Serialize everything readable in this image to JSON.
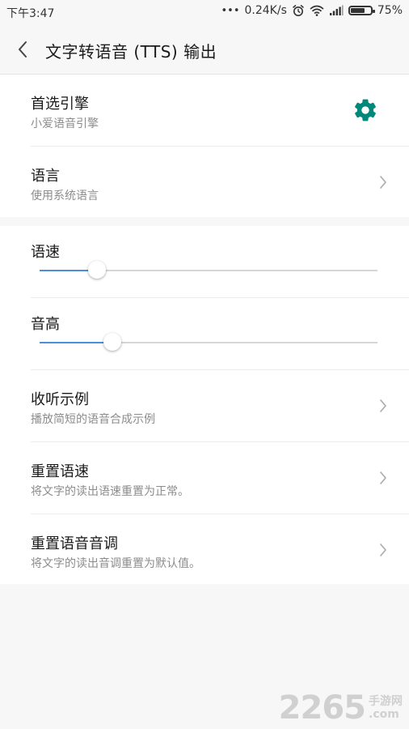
{
  "status_bar": {
    "time": "下午3:47",
    "dots": "•••",
    "network_speed": "0.24K/s",
    "battery_percent": "75%",
    "battery_level": 0.75,
    "icons": [
      "alarm-icon",
      "wifi-icon",
      "signal-icon",
      "battery-icon"
    ]
  },
  "header": {
    "title": "文字转语音 (TTS) 输出",
    "back_icon": "chevron-left-icon"
  },
  "engine": {
    "title": "首选引擎",
    "subtitle": "小爱语音引擎",
    "icon": "gear-icon",
    "icon_color": "#00897b"
  },
  "language": {
    "title": "语言",
    "subtitle": "使用系统语言"
  },
  "speech_rate": {
    "title": "语速",
    "value": 0.17
  },
  "pitch": {
    "title": "音高",
    "value": 0.215
  },
  "listen_example": {
    "title": "收听示例",
    "subtitle": "播放简短的语音合成示例"
  },
  "reset_rate": {
    "title": "重置语速",
    "subtitle": "将文字的读出语速重置为正常。"
  },
  "reset_pitch": {
    "title": "重置语音音调",
    "subtitle": "将文字的读出音调重置为默认值。"
  },
  "colors": {
    "accent": "#4a90d9",
    "background": "#f7f7f7",
    "card": "#ffffff"
  },
  "watermark": {
    "big": "2265",
    "small_top": "手游网",
    "small_bottom": ".com"
  }
}
